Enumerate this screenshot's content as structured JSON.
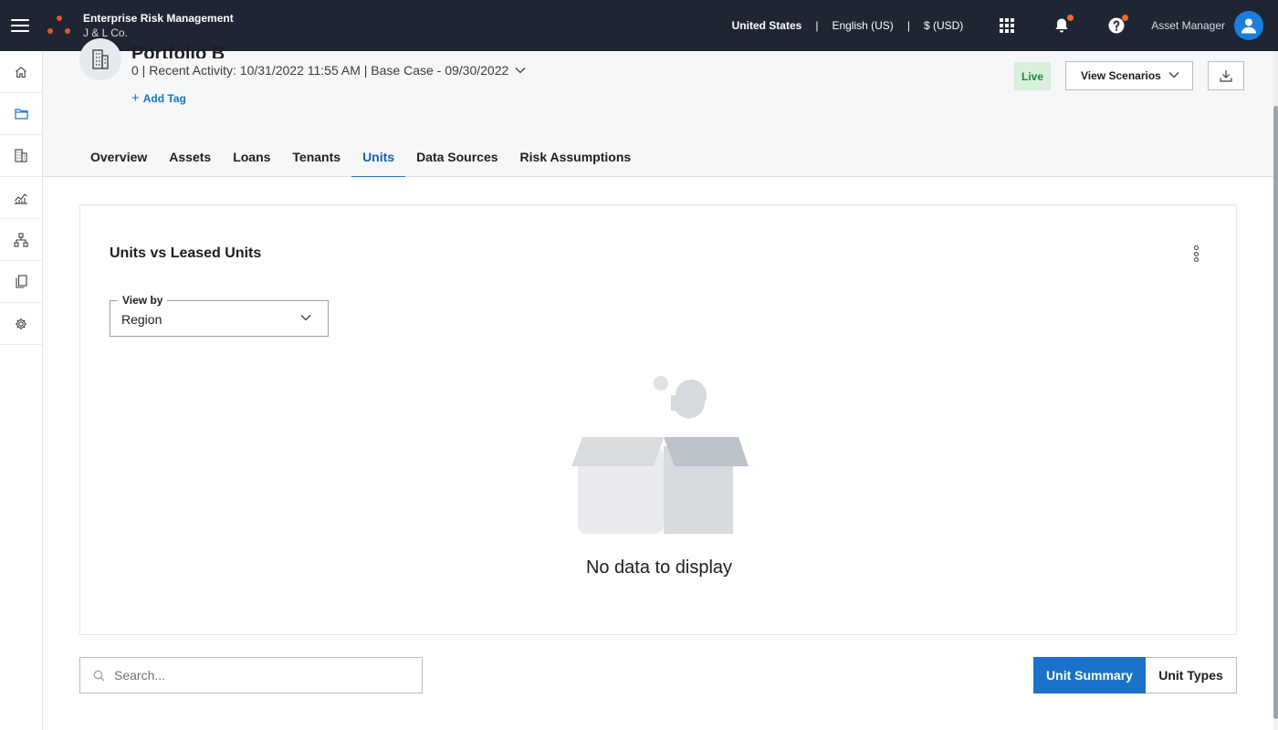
{
  "topbar": {
    "app_name": "Enterprise Risk Management",
    "company": "J & L Co.",
    "region": "United States",
    "language": "English (US)",
    "currency": "$ (USD)",
    "separator": "|",
    "user_role": "Asset Manager",
    "icons": [
      "menu-icon",
      "apps-grid-icon",
      "bell-icon",
      "help-icon",
      "user-icon"
    ]
  },
  "sidebar": {
    "items": [
      {
        "name": "home",
        "icon": "home-icon"
      },
      {
        "name": "portfolios",
        "icon": "folder-icon"
      },
      {
        "name": "assets",
        "icon": "building-icon"
      },
      {
        "name": "analytics",
        "icon": "chart-icon"
      },
      {
        "name": "hierarchy",
        "icon": "hierarchy-icon"
      },
      {
        "name": "documents",
        "icon": "documents-icon"
      },
      {
        "name": "settings",
        "icon": "gear-icon"
      }
    ]
  },
  "header": {
    "title": "Portfolio B",
    "meta": "0  | Recent Activity: 10/31/2022 11:55 AM | Base Case - 09/30/2022",
    "add_tag_label": "Add Tag",
    "live_label": "Live",
    "view_scenarios_label": "View Scenarios"
  },
  "tabs": [
    {
      "label": "Overview",
      "active": false
    },
    {
      "label": "Assets",
      "active": false
    },
    {
      "label": "Loans",
      "active": false
    },
    {
      "label": "Tenants",
      "active": false
    },
    {
      "label": "Units",
      "active": true
    },
    {
      "label": "Data Sources",
      "active": false
    },
    {
      "label": "Risk Assumptions",
      "active": false
    }
  ],
  "card": {
    "title": "Units vs Leased Units",
    "view_by_label": "View by",
    "view_by_value": "Region",
    "empty_text": "No data to display"
  },
  "bottom": {
    "search_placeholder": "Search...",
    "unit_summary_label": "Unit Summary",
    "unit_types_label": "Unit Types"
  },
  "colors": {
    "topbar_bg": "#1e2633",
    "accent": "#1a73c8",
    "notification": "#f26b2a",
    "live_bg": "#d9f0dc",
    "live_text": "#1b8a36",
    "logo": "#e8552d"
  }
}
